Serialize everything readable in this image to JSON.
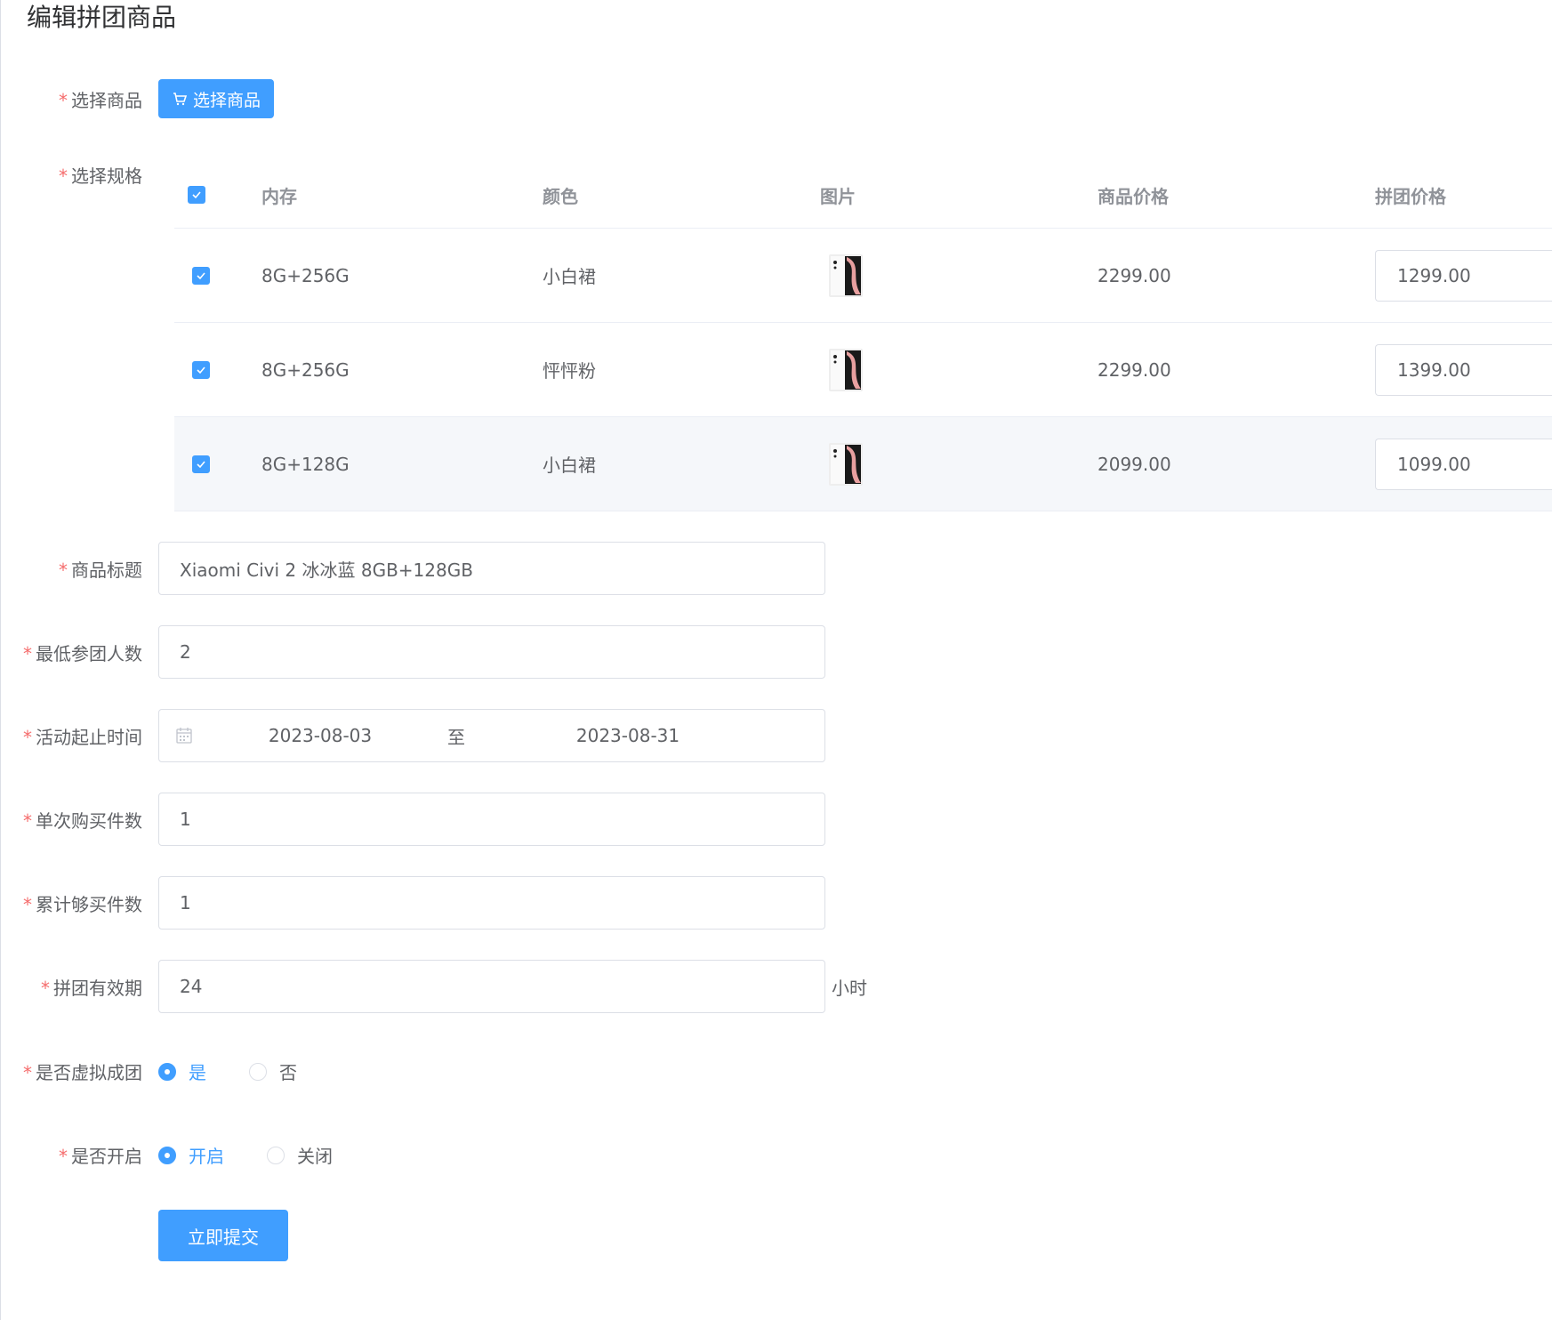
{
  "page_title": "编辑拼团商品",
  "form": {
    "select_goods": {
      "label": "选择商品",
      "button": "选择商品"
    },
    "select_spec": {
      "label": "选择规格",
      "columns": [
        "内存",
        "颜色",
        "图片",
        "商品价格",
        "拼团价格"
      ],
      "rows": [
        {
          "memory": "8G+256G",
          "color": "小白裙",
          "price": "2299.00",
          "group_price": "1299.00"
        },
        {
          "memory": "8G+256G",
          "color": "怦怦粉",
          "price": "2299.00",
          "group_price": "1399.00"
        },
        {
          "memory": "8G+128G",
          "color": "小白裙",
          "price": "2099.00",
          "group_price": "1099.00"
        }
      ]
    },
    "title": {
      "label": "商品标题",
      "value": "Xiaomi Civi 2 冰冰蓝 8GB+128GB"
    },
    "min_people": {
      "label": "最低参团人数",
      "value": "2"
    },
    "period": {
      "label": "活动起止时间",
      "start": "2023-08-03",
      "separator": "至",
      "end": "2023-08-31"
    },
    "single_qty": {
      "label": "单次购买件数",
      "value": "1"
    },
    "total_qty": {
      "label": "累计够买件数",
      "value": "1"
    },
    "validity": {
      "label": "拼团有效期",
      "value": "24",
      "suffix": "小时"
    },
    "virtual": {
      "label": "是否虚拟成团",
      "yes": "是",
      "no": "否"
    },
    "enabled": {
      "label": "是否开启",
      "on": "开启",
      "off": "关闭"
    },
    "submit": "立即提交"
  },
  "colors": {
    "primary": "#409eff",
    "required": "#f56c6c",
    "border": "#dcdfe6"
  }
}
